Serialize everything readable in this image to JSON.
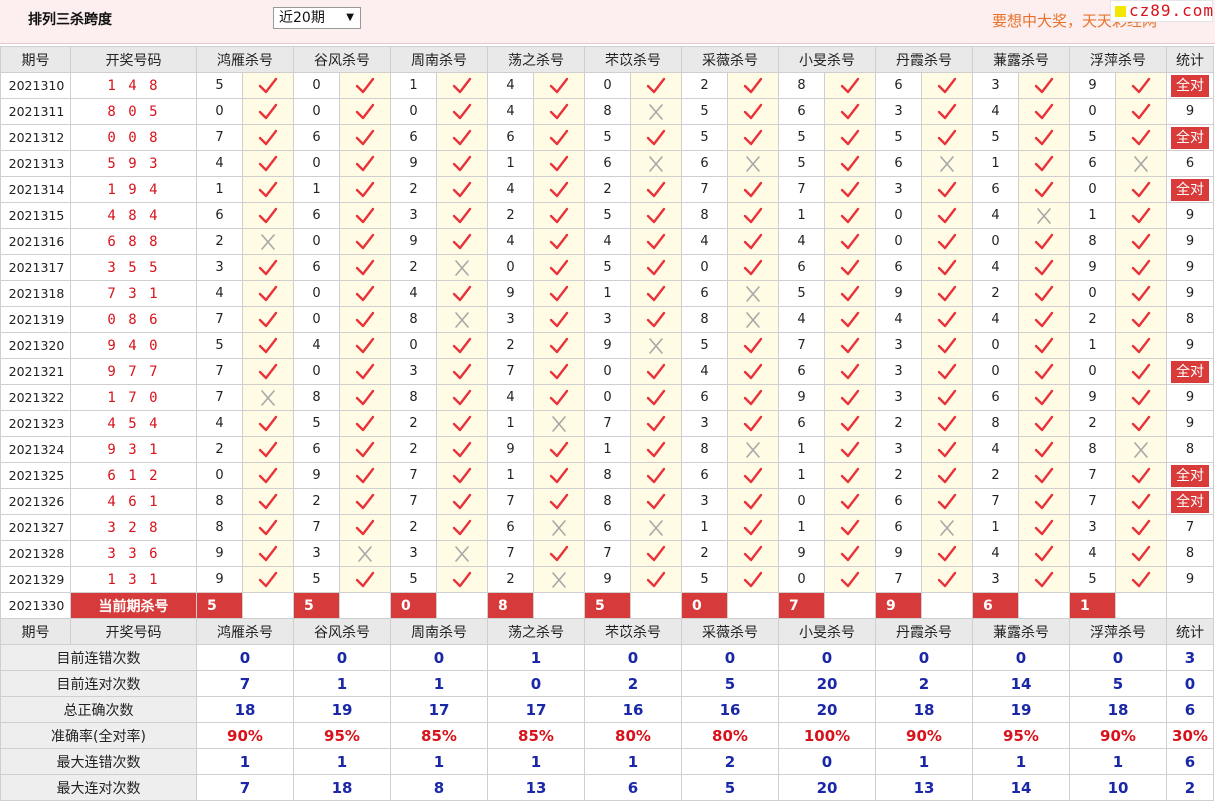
{
  "header": {
    "title": "排列三杀跨度",
    "period_select": "近20期",
    "slogan": "要想中大奖，天天彩经网",
    "logo": "cz89.com"
  },
  "columns": {
    "period": "期号",
    "draw": "开奖号码",
    "experts": [
      "鸿雁杀号",
      "谷风杀号",
      "周南杀号",
      "荡之杀号",
      "芣苡杀号",
      "采薇杀号",
      "小旻杀号",
      "丹霞杀号",
      "蒹露杀号",
      "浮萍杀号"
    ],
    "stat": "统计"
  },
  "rows": [
    {
      "period": "2021310",
      "draw": "1 4 8",
      "kills": [
        "5",
        "0",
        "1",
        "4",
        "0",
        "2",
        "8",
        "6",
        "3",
        "9"
      ],
      "marks": [
        1,
        1,
        1,
        1,
        1,
        1,
        1,
        1,
        1,
        1
      ],
      "stat": "全对"
    },
    {
      "period": "2021311",
      "draw": "8 0 5",
      "kills": [
        "0",
        "0",
        "0",
        "4",
        "8",
        "5",
        "6",
        "3",
        "4",
        "0"
      ],
      "marks": [
        1,
        1,
        1,
        1,
        0,
        1,
        1,
        1,
        1,
        1
      ],
      "stat": "9"
    },
    {
      "period": "2021312",
      "draw": "0 0 8",
      "kills": [
        "7",
        "6",
        "6",
        "6",
        "5",
        "5",
        "5",
        "5",
        "5",
        "5"
      ],
      "marks": [
        1,
        1,
        1,
        1,
        1,
        1,
        1,
        1,
        1,
        1
      ],
      "stat": "全对"
    },
    {
      "period": "2021313",
      "draw": "5 9 3",
      "kills": [
        "4",
        "0",
        "9",
        "1",
        "6",
        "6",
        "5",
        "6",
        "1",
        "6"
      ],
      "marks": [
        1,
        1,
        1,
        1,
        0,
        0,
        1,
        0,
        1,
        0
      ],
      "stat": "6"
    },
    {
      "period": "2021314",
      "draw": "1 9 4",
      "kills": [
        "1",
        "1",
        "2",
        "4",
        "2",
        "7",
        "7",
        "3",
        "6",
        "0"
      ],
      "marks": [
        1,
        1,
        1,
        1,
        1,
        1,
        1,
        1,
        1,
        1
      ],
      "stat": "全对"
    },
    {
      "period": "2021315",
      "draw": "4 8 4",
      "kills": [
        "6",
        "6",
        "3",
        "2",
        "5",
        "8",
        "1",
        "0",
        "4",
        "1"
      ],
      "marks": [
        1,
        1,
        1,
        1,
        1,
        1,
        1,
        1,
        0,
        1
      ],
      "stat": "9"
    },
    {
      "period": "2021316",
      "draw": "6 8 8",
      "kills": [
        "2",
        "0",
        "9",
        "4",
        "4",
        "4",
        "4",
        "0",
        "0",
        "8"
      ],
      "marks": [
        0,
        1,
        1,
        1,
        1,
        1,
        1,
        1,
        1,
        1
      ],
      "stat": "9"
    },
    {
      "period": "2021317",
      "draw": "3 5 5",
      "kills": [
        "3",
        "6",
        "2",
        "0",
        "5",
        "0",
        "6",
        "6",
        "4",
        "9"
      ],
      "marks": [
        1,
        1,
        0,
        1,
        1,
        1,
        1,
        1,
        1,
        1
      ],
      "stat": "9"
    },
    {
      "period": "2021318",
      "draw": "7 3 1",
      "kills": [
        "4",
        "0",
        "4",
        "9",
        "1",
        "6",
        "5",
        "9",
        "2",
        "0"
      ],
      "marks": [
        1,
        1,
        1,
        1,
        1,
        0,
        1,
        1,
        1,
        1
      ],
      "stat": "9"
    },
    {
      "period": "2021319",
      "draw": "0 8 6",
      "kills": [
        "7",
        "0",
        "8",
        "3",
        "3",
        "8",
        "4",
        "4",
        "4",
        "2"
      ],
      "marks": [
        1,
        1,
        0,
        1,
        1,
        0,
        1,
        1,
        1,
        1
      ],
      "stat": "8"
    },
    {
      "period": "2021320",
      "draw": "9 4 0",
      "kills": [
        "5",
        "4",
        "0",
        "2",
        "9",
        "5",
        "7",
        "3",
        "0",
        "1"
      ],
      "marks": [
        1,
        1,
        1,
        1,
        0,
        1,
        1,
        1,
        1,
        1
      ],
      "stat": "9"
    },
    {
      "period": "2021321",
      "draw": "9 7 7",
      "kills": [
        "7",
        "0",
        "3",
        "7",
        "0",
        "4",
        "6",
        "3",
        "0",
        "0"
      ],
      "marks": [
        1,
        1,
        1,
        1,
        1,
        1,
        1,
        1,
        1,
        1
      ],
      "stat": "全对"
    },
    {
      "period": "2021322",
      "draw": "1 7 0",
      "kills": [
        "7",
        "8",
        "8",
        "4",
        "0",
        "6",
        "9",
        "3",
        "6",
        "9"
      ],
      "marks": [
        0,
        1,
        1,
        1,
        1,
        1,
        1,
        1,
        1,
        1
      ],
      "stat": "9"
    },
    {
      "period": "2021323",
      "draw": "4 5 4",
      "kills": [
        "4",
        "5",
        "2",
        "1",
        "7",
        "3",
        "6",
        "2",
        "8",
        "2"
      ],
      "marks": [
        1,
        1,
        1,
        0,
        1,
        1,
        1,
        1,
        1,
        1
      ],
      "stat": "9"
    },
    {
      "period": "2021324",
      "draw": "9 3 1",
      "kills": [
        "2",
        "6",
        "2",
        "9",
        "1",
        "8",
        "1",
        "3",
        "4",
        "8"
      ],
      "marks": [
        1,
        1,
        1,
        1,
        1,
        0,
        1,
        1,
        1,
        0
      ],
      "stat": "8"
    },
    {
      "period": "2021325",
      "draw": "6 1 2",
      "kills": [
        "0",
        "9",
        "7",
        "1",
        "8",
        "6",
        "1",
        "2",
        "2",
        "7"
      ],
      "marks": [
        1,
        1,
        1,
        1,
        1,
        1,
        1,
        1,
        1,
        1
      ],
      "stat": "全对"
    },
    {
      "period": "2021326",
      "draw": "4 6 1",
      "kills": [
        "8",
        "2",
        "7",
        "7",
        "8",
        "3",
        "0",
        "6",
        "7",
        "7"
      ],
      "marks": [
        1,
        1,
        1,
        1,
        1,
        1,
        1,
        1,
        1,
        1
      ],
      "stat": "全对"
    },
    {
      "period": "2021327",
      "draw": "3 2 8",
      "kills": [
        "8",
        "7",
        "2",
        "6",
        "6",
        "1",
        "1",
        "6",
        "1",
        "3"
      ],
      "marks": [
        1,
        1,
        1,
        0,
        0,
        1,
        1,
        0,
        1,
        1
      ],
      "stat": "7"
    },
    {
      "period": "2021328",
      "draw": "3 3 6",
      "kills": [
        "9",
        "3",
        "3",
        "7",
        "7",
        "2",
        "9",
        "9",
        "4",
        "4"
      ],
      "marks": [
        1,
        0,
        0,
        1,
        1,
        1,
        1,
        1,
        1,
        1
      ],
      "stat": "8"
    },
    {
      "period": "2021329",
      "draw": "1 3 1",
      "kills": [
        "9",
        "5",
        "5",
        "2",
        "9",
        "5",
        "0",
        "7",
        "3",
        "5"
      ],
      "marks": [
        1,
        1,
        1,
        0,
        1,
        1,
        1,
        1,
        1,
        1
      ],
      "stat": "9"
    }
  ],
  "current": {
    "period": "2021330",
    "label": "当前期杀号",
    "kills": [
      "5",
      "5",
      "0",
      "8",
      "5",
      "0",
      "7",
      "9",
      "6",
      "1"
    ]
  },
  "stats": [
    {
      "label": "目前连错次数",
      "values": [
        "0",
        "0",
        "0",
        "1",
        "0",
        "0",
        "0",
        "0",
        "0",
        "0"
      ],
      "total": "3",
      "kind": "num"
    },
    {
      "label": "目前连对次数",
      "values": [
        "7",
        "1",
        "1",
        "0",
        "2",
        "5",
        "20",
        "2",
        "14",
        "5"
      ],
      "total": "0",
      "kind": "num"
    },
    {
      "label": "总正确次数",
      "values": [
        "18",
        "19",
        "17",
        "17",
        "16",
        "16",
        "20",
        "18",
        "19",
        "18"
      ],
      "total": "6",
      "kind": "num"
    },
    {
      "label": "准确率(全对率)",
      "values": [
        "90%",
        "95%",
        "85%",
        "85%",
        "80%",
        "80%",
        "100%",
        "90%",
        "95%",
        "90%"
      ],
      "total": "30%",
      "kind": "pct"
    },
    {
      "label": "最大连错次数",
      "values": [
        "1",
        "1",
        "1",
        "1",
        "1",
        "2",
        "0",
        "1",
        "1",
        "1"
      ],
      "total": "6",
      "kind": "num"
    },
    {
      "label": "最大连对次数",
      "values": [
        "7",
        "18",
        "8",
        "13",
        "6",
        "5",
        "20",
        "13",
        "14",
        "10"
      ],
      "total": "2",
      "kind": "num"
    }
  ],
  "colors": {
    "check": "#e8333a",
    "cross": "#a8a8a8",
    "highlight": "#d63a3a",
    "stat_blue": "#1a28a8"
  }
}
